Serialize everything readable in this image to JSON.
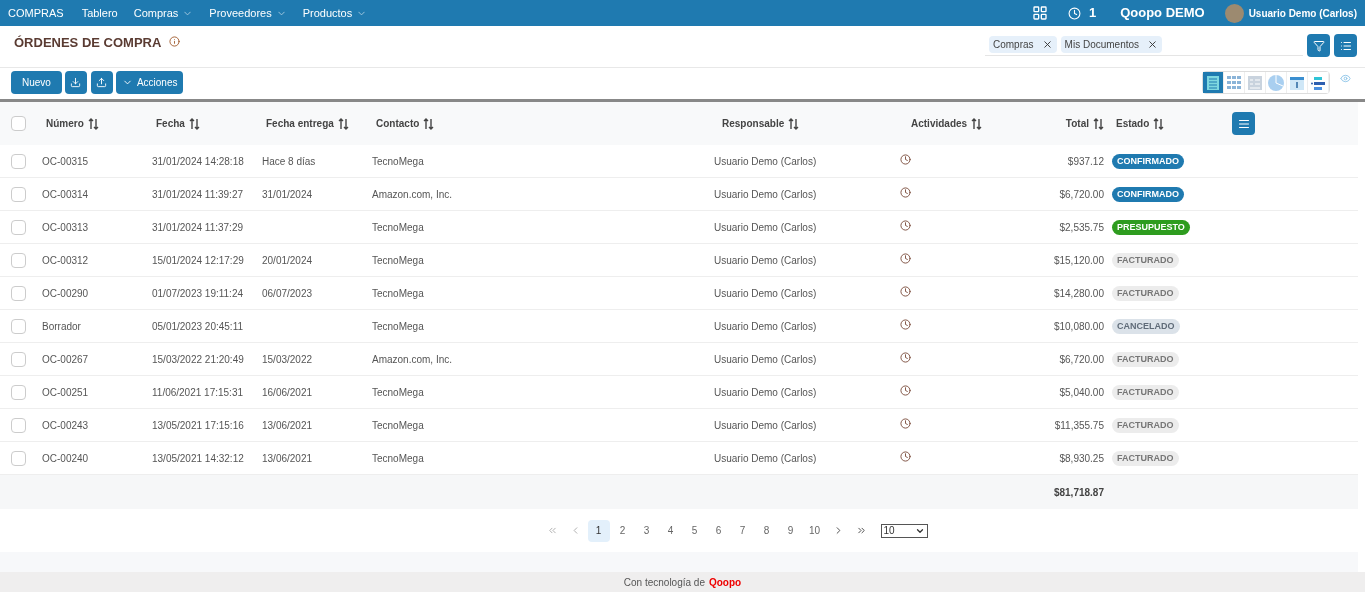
{
  "topbar": {
    "app": "COMPRAS",
    "menu": [
      {
        "label": "Tablero",
        "dropdown": false
      },
      {
        "label": "Compras",
        "dropdown": true
      },
      {
        "label": "Proveedores",
        "dropdown": true
      },
      {
        "label": "Productos",
        "dropdown": true
      }
    ],
    "activity_count": "1",
    "company": "Qoopo DEMO",
    "user": "Usuario Demo (Carlos)"
  },
  "page": {
    "title": "ÓRDENES DE COMPRA",
    "filters": [
      {
        "label": "Compras"
      },
      {
        "label": "Mis Documentos"
      }
    ]
  },
  "toolbar": {
    "new_button": "Nuevo",
    "actions_button": "Acciones"
  },
  "views": [
    {
      "kind": "list",
      "selected": true
    },
    {
      "kind": "grid",
      "selected": false
    },
    {
      "kind": "detail",
      "selected": false
    },
    {
      "kind": "pie",
      "selected": false
    },
    {
      "kind": "calendar",
      "selected": false
    },
    {
      "kind": "gantt",
      "selected": false
    }
  ],
  "table": {
    "select_all_checked": false,
    "columns": [
      "Número",
      "Fecha",
      "Fecha entrega",
      "Contacto",
      "Responsable",
      "Actividades",
      "Total",
      "Estado"
    ],
    "rows": [
      {
        "checked": false,
        "number": "OC-00315",
        "date": "31/01/2024 14:28:18",
        "delivery": "Hace 8 días",
        "contact": "TecnoMega",
        "owner": "Usuario Demo (Carlos)",
        "total": "$937.12",
        "status": {
          "label": "CONFIRMADO",
          "kind": "confirmed"
        }
      },
      {
        "checked": false,
        "number": "OC-00314",
        "date": "31/01/2024 11:39:27",
        "delivery": "31/01/2024",
        "contact": "Amazon.com, Inc.",
        "owner": "Usuario Demo (Carlos)",
        "total": "$6,720.00",
        "status": {
          "label": "CONFIRMADO",
          "kind": "confirmed"
        }
      },
      {
        "checked": false,
        "number": "OC-00313",
        "date": "31/01/2024 11:37:29",
        "contact": "TecnoMega",
        "owner": "Usuario Demo (Carlos)",
        "total": "$2,535.75",
        "status": {
          "label": "PRESUPUESTO",
          "kind": "quote"
        }
      },
      {
        "checked": false,
        "number": "OC-00312",
        "date": "15/01/2024 12:17:29",
        "delivery": "20/01/2024",
        "contact": "TecnoMega",
        "owner": "Usuario Demo (Carlos)",
        "total": "$15,120.00",
        "status": {
          "label": "FACTURADO",
          "kind": "invoiced"
        }
      },
      {
        "checked": false,
        "number": "OC-00290",
        "date": "01/07/2023 19:11:24",
        "delivery": "06/07/2023",
        "contact": "TecnoMega",
        "owner": "Usuario Demo (Carlos)",
        "total": "$14,280.00",
        "status": {
          "label": "FACTURADO",
          "kind": "invoiced"
        }
      },
      {
        "checked": false,
        "number": "Borrador",
        "date": "05/01/2023 20:45:11",
        "contact": "TecnoMega",
        "owner": "Usuario Demo (Carlos)",
        "total": "$10,080.00",
        "status": {
          "label": "CANCELADO",
          "kind": "cancelled"
        }
      },
      {
        "checked": false,
        "number": "OC-00267",
        "date": "15/03/2022 21:20:49",
        "delivery": "15/03/2022",
        "contact": "Amazon.com, Inc.",
        "owner": "Usuario Demo (Carlos)",
        "total": "$6,720.00",
        "status": {
          "label": "FACTURADO",
          "kind": "invoiced"
        }
      },
      {
        "checked": false,
        "number": "OC-00251",
        "date": "11/06/2021 17:15:31",
        "delivery": "16/06/2021",
        "contact": "TecnoMega",
        "owner": "Usuario Demo (Carlos)",
        "total": "$5,040.00",
        "status": {
          "label": "FACTURADO",
          "kind": "invoiced"
        }
      },
      {
        "checked": false,
        "number": "OC-00243",
        "date": "13/05/2021 17:15:16",
        "delivery": "13/06/2021",
        "contact": "TecnoMega",
        "owner": "Usuario Demo (Carlos)",
        "total": "$11,355.75",
        "status": {
          "label": "FACTURADO",
          "kind": "invoiced"
        }
      },
      {
        "checked": false,
        "number": "OC-00240",
        "date": "13/05/2021 14:32:12",
        "delivery": "13/06/2021",
        "contact": "TecnoMega",
        "owner": "Usuario Demo (Carlos)",
        "total": "$8,930.25",
        "status": {
          "label": "FACTURADO",
          "kind": "invoiced"
        }
      }
    ],
    "grand_total": "$81,718.87"
  },
  "pagination": {
    "pages": [
      {
        "label": "1",
        "selected": true
      },
      {
        "label": "2",
        "selected": false
      },
      {
        "label": "3",
        "selected": false
      },
      {
        "label": "4",
        "selected": false
      },
      {
        "label": "5",
        "selected": false
      },
      {
        "label": "6",
        "selected": false
      },
      {
        "label": "7",
        "selected": false
      },
      {
        "label": "8",
        "selected": false
      },
      {
        "label": "9",
        "selected": false
      },
      {
        "label": "10",
        "selected": false
      }
    ],
    "page_size": "10"
  },
  "footer": {
    "text": "Con tecnología de",
    "brand": "Qoopo"
  }
}
